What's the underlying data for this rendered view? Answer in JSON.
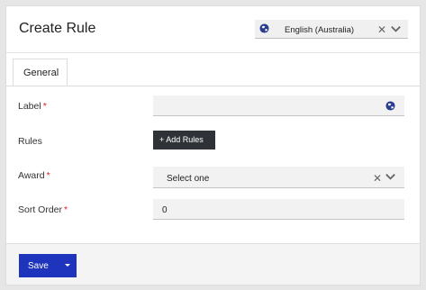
{
  "header": {
    "title": "Create Rule",
    "language": {
      "value": "English (Australia)"
    }
  },
  "tabs": [
    {
      "label": "General"
    }
  ],
  "form": {
    "label_field": {
      "label": "Label",
      "required_mark": "*",
      "value": ""
    },
    "rules_field": {
      "label": "Rules",
      "button_label": "+ Add Rules"
    },
    "award_field": {
      "label": "Award",
      "required_mark": "*",
      "value": "Select one"
    },
    "sort_order_field": {
      "label": "Sort Order",
      "required_mark": "*",
      "value": "0"
    }
  },
  "footer": {
    "save_label": "Save"
  },
  "icons": {
    "globe": "globe-icon",
    "clear": "close-icon",
    "dropdown": "chevron-down-icon",
    "caret": "caret-down-icon"
  },
  "colors": {
    "primary": "#1f34bd",
    "dark_button": "#2f3337",
    "required": "#d22222",
    "globe": "#2b3d8f"
  }
}
